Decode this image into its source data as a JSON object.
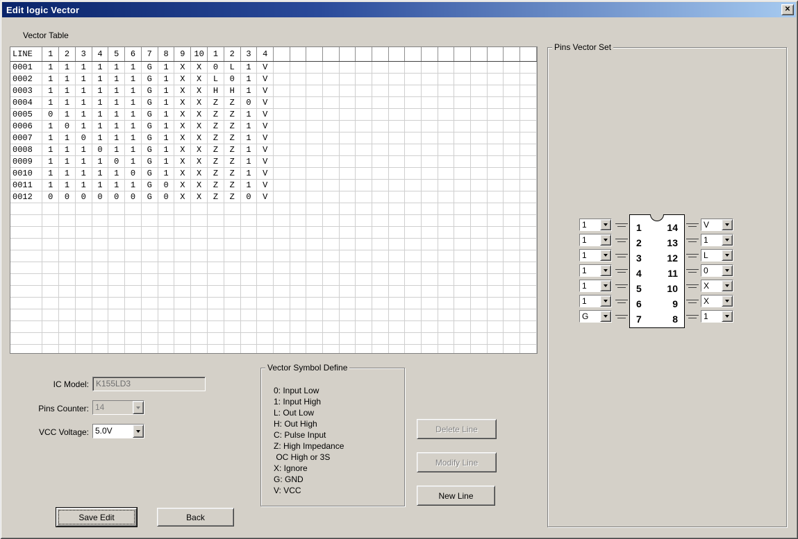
{
  "window": {
    "title": "Edit logic Vector",
    "close_glyph": "✕"
  },
  "vector_table": {
    "label": "Vector Table",
    "columns": [
      "LINE",
      "1",
      "2",
      "3",
      "4",
      "5",
      "6",
      "7",
      "8",
      "9",
      "10",
      "1",
      "2",
      "3",
      "4"
    ],
    "rows": [
      {
        "line": "0001",
        "values": [
          "1",
          "1",
          "1",
          "1",
          "1",
          "1",
          "G",
          "1",
          "X",
          "X",
          "0",
          "L",
          "1",
          "V"
        ]
      },
      {
        "line": "0002",
        "values": [
          "1",
          "1",
          "1",
          "1",
          "1",
          "1",
          "G",
          "1",
          "X",
          "X",
          "L",
          "0",
          "1",
          "V"
        ]
      },
      {
        "line": "0003",
        "values": [
          "1",
          "1",
          "1",
          "1",
          "1",
          "1",
          "G",
          "1",
          "X",
          "X",
          "H",
          "H",
          "1",
          "V"
        ]
      },
      {
        "line": "0004",
        "values": [
          "1",
          "1",
          "1",
          "1",
          "1",
          "1",
          "G",
          "1",
          "X",
          "X",
          "Z",
          "Z",
          "0",
          "V"
        ]
      },
      {
        "line": "0005",
        "values": [
          "0",
          "1",
          "1",
          "1",
          "1",
          "1",
          "G",
          "1",
          "X",
          "X",
          "Z",
          "Z",
          "1",
          "V"
        ]
      },
      {
        "line": "0006",
        "values": [
          "1",
          "0",
          "1",
          "1",
          "1",
          "1",
          "G",
          "1",
          "X",
          "X",
          "Z",
          "Z",
          "1",
          "V"
        ]
      },
      {
        "line": "0007",
        "values": [
          "1",
          "1",
          "0",
          "1",
          "1",
          "1",
          "G",
          "1",
          "X",
          "X",
          "Z",
          "Z",
          "1",
          "V"
        ]
      },
      {
        "line": "0008",
        "values": [
          "1",
          "1",
          "1",
          "0",
          "1",
          "1",
          "G",
          "1",
          "X",
          "X",
          "Z",
          "Z",
          "1",
          "V"
        ]
      },
      {
        "line": "0009",
        "values": [
          "1",
          "1",
          "1",
          "1",
          "0",
          "1",
          "G",
          "1",
          "X",
          "X",
          "Z",
          "Z",
          "1",
          "V"
        ]
      },
      {
        "line": "0010",
        "values": [
          "1",
          "1",
          "1",
          "1",
          "1",
          "0",
          "G",
          "1",
          "X",
          "X",
          "Z",
          "Z",
          "1",
          "V"
        ]
      },
      {
        "line": "0011",
        "values": [
          "1",
          "1",
          "1",
          "1",
          "1",
          "1",
          "G",
          "0",
          "X",
          "X",
          "Z",
          "Z",
          "1",
          "V"
        ]
      },
      {
        "line": "0012",
        "values": [
          "0",
          "0",
          "0",
          "0",
          "0",
          "0",
          "G",
          "0",
          "X",
          "X",
          "Z",
          "Z",
          "0",
          "V"
        ]
      }
    ]
  },
  "pins_vector_set": {
    "label": "Pins Vector Set",
    "left_pins": [
      {
        "pin": "1",
        "value": "1"
      },
      {
        "pin": "2",
        "value": "1"
      },
      {
        "pin": "3",
        "value": "1"
      },
      {
        "pin": "4",
        "value": "1"
      },
      {
        "pin": "5",
        "value": "1"
      },
      {
        "pin": "6",
        "value": "1"
      },
      {
        "pin": "7",
        "value": "G"
      }
    ],
    "right_pins": [
      {
        "pin": "14",
        "value": "V"
      },
      {
        "pin": "13",
        "value": "1"
      },
      {
        "pin": "12",
        "value": "L"
      },
      {
        "pin": "11",
        "value": "0"
      },
      {
        "pin": "10",
        "value": "X"
      },
      {
        "pin": "9",
        "value": "X"
      },
      {
        "pin": "8",
        "value": "1"
      }
    ]
  },
  "form": {
    "ic_model_label": "IC Model:",
    "ic_model_value": "K155LD3",
    "pins_counter_label": "Pins Counter:",
    "pins_counter_value": "14",
    "vcc_label": "VCC Voltage:",
    "vcc_value": "5.0V"
  },
  "symbol_define": {
    "label": "Vector Symbol Define",
    "lines": [
      "0: Input Low",
      "1: Input High",
      "L: Out Low",
      "H: Out High",
      "C: Pulse Input",
      "Z: High Impedance",
      " OC High or 3S",
      "X: Ignore",
      "G: GND",
      "V: VCC"
    ]
  },
  "buttons": {
    "delete_line": "Delete Line",
    "modify_line": "Modify Line",
    "new_line": "New Line",
    "save_edit": "Save Edit",
    "back": "Back"
  }
}
